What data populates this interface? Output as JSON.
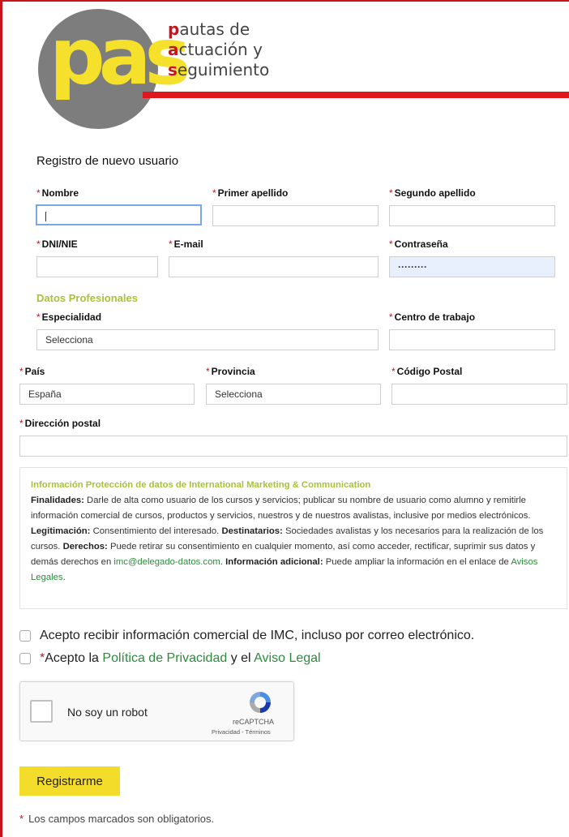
{
  "logo": {
    "letters": "pas",
    "line1_initial": "p",
    "line1_rest": "autas de",
    "line2_initial": "a",
    "line2_rest": "ctuación y",
    "line3_initial": "s",
    "line3_rest": "eguimiento"
  },
  "form": {
    "title": "Registro de nuevo usuario",
    "required_mark": "*",
    "fields": {
      "nombre": {
        "label": "Nombre",
        "value": ""
      },
      "primer_apellido": {
        "label": "Primer apellido",
        "value": ""
      },
      "segundo_apellido": {
        "label": "Segundo apellido",
        "value": ""
      },
      "dni": {
        "label": "DNI/NIE",
        "value": ""
      },
      "email": {
        "label": "E-mail",
        "value": ""
      },
      "contrasena": {
        "label": "Contraseña",
        "value": "·········"
      },
      "especialidad": {
        "label": "Especialidad",
        "value": "Selecciona"
      },
      "centro": {
        "label": "Centro de trabajo",
        "value": ""
      },
      "pais": {
        "label": "País",
        "value": "España"
      },
      "provincia": {
        "label": "Provincia",
        "value": "Selecciona"
      },
      "cp": {
        "label": "Código Postal",
        "value": ""
      },
      "direccion": {
        "label": "Dirección postal",
        "value": ""
      }
    },
    "professional_section": "Datos Profesionales"
  },
  "privacy": {
    "title": "Información Protección de datos de International Marketing & Communication",
    "finalidades_label": "Finalidades:",
    "finalidades_text": " Darle de alta como usuario de los cursos y servicios; publicar su nombre de usuario como alumno y remitirle información comercial de cursos, productos y servicios, nuestros y de nuestros avalistas, inclusive por medios electrónicos. ",
    "legitimacion_label": "Legitimación:",
    "legitimacion_text": " Consentimiento del interesado. ",
    "destinatarios_label": "Destinatarios:",
    "destinatarios_text": " Sociedades avalistas y los necesarios para la realización de los cursos. ",
    "derechos_label": "Derechos:",
    "derechos_text": " Puede retirar su consentimiento en cualquier momento, así como acceder, rectificar, suprimir sus datos y demás derechos en ",
    "email_link": "imc@delegado-datos.com",
    "period": ". ",
    "adicional_label": "Información adicional:",
    "adicional_text": " Puede ampliar la información en el enlace de ",
    "avisos_link": "Avisos Legales",
    "end": "."
  },
  "consent": {
    "commercial": "Acepto recibir información comercial de IMC, incluso por correo electrónico.",
    "privacy_prefix": "*",
    "privacy_text1": "Acepto la ",
    "privacy_link": "Política de Privacidad",
    "privacy_text2": " y el ",
    "legal_link": "Aviso Legal"
  },
  "recaptcha": {
    "label": "No soy un robot",
    "brand": "reCAPTCHA",
    "terms": "Privacidad - Términos"
  },
  "submit_label": "Registrarme",
  "footnote": "Los campos marcados son obligatorios.",
  "colors": {
    "accent_red": "#c8141c",
    "accent_yellow": "#f3dd2a",
    "accent_green": "#a8c23a",
    "link_green": "#2d8a3e"
  }
}
